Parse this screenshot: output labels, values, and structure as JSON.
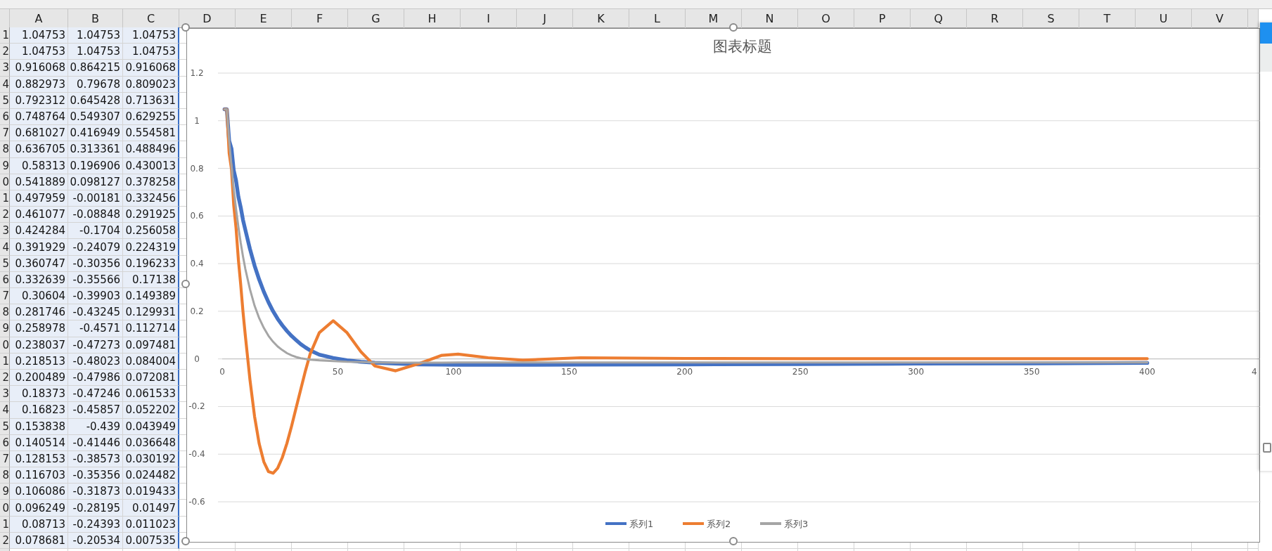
{
  "columns": [
    "A",
    "B",
    "C",
    "D",
    "E",
    "F",
    "G",
    "H",
    "I",
    "J",
    "K",
    "L",
    "M",
    "N",
    "O",
    "P",
    "Q",
    "R",
    "S",
    "T",
    "U",
    "V"
  ],
  "rows": [
    {
      "header": "1",
      "cells": [
        "1.04753",
        "1.04753",
        "1.04753"
      ]
    },
    {
      "header": "2",
      "cells": [
        "1.04753",
        "1.04753",
        "1.04753"
      ]
    },
    {
      "header": "3",
      "cells": [
        "0.916068",
        "0.864215",
        "0.916068"
      ]
    },
    {
      "header": "4",
      "cells": [
        "0.882973",
        "0.79678",
        "0.809023"
      ]
    },
    {
      "header": "5",
      "cells": [
        "0.792312",
        "0.645428",
        "0.713631"
      ]
    },
    {
      "header": "6",
      "cells": [
        "0.748764",
        "0.549307",
        "0.629255"
      ]
    },
    {
      "header": "7",
      "cells": [
        "0.681027",
        "0.416949",
        "0.554581"
      ]
    },
    {
      "header": "8",
      "cells": [
        "0.636705",
        "0.313361",
        "0.488496"
      ]
    },
    {
      "header": "9",
      "cells": [
        "0.58313",
        "0.196906",
        "0.430013"
      ]
    },
    {
      "header": "0",
      "cells": [
        "0.541889",
        "0.098127",
        "0.378258"
      ]
    },
    {
      "header": "1",
      "cells": [
        "0.497959",
        "-0.00181",
        "0.332456"
      ]
    },
    {
      "header": "2",
      "cells": [
        "0.461077",
        "-0.08848",
        "0.291925"
      ]
    },
    {
      "header": "3",
      "cells": [
        "0.424284",
        "-0.1704",
        "0.256058"
      ]
    },
    {
      "header": "4",
      "cells": [
        "0.391929",
        "-0.24079",
        "0.224319"
      ]
    },
    {
      "header": "5",
      "cells": [
        "0.360747",
        "-0.30356",
        "0.196233"
      ]
    },
    {
      "header": "6",
      "cells": [
        "0.332639",
        "-0.35566",
        "0.17138"
      ]
    },
    {
      "header": "7",
      "cells": [
        "0.30604",
        "-0.39903",
        "0.149389"
      ]
    },
    {
      "header": "8",
      "cells": [
        "0.281746",
        "-0.43245",
        "0.129931"
      ]
    },
    {
      "header": "9",
      "cells": [
        "0.258978",
        "-0.4571",
        "0.112714"
      ]
    },
    {
      "header": "0",
      "cells": [
        "0.238037",
        "-0.47273",
        "0.097481"
      ]
    },
    {
      "header": "1",
      "cells": [
        "0.218513",
        "-0.48023",
        "0.084004"
      ]
    },
    {
      "header": "2",
      "cells": [
        "0.200489",
        "-0.47986",
        "0.072081"
      ]
    },
    {
      "header": "3",
      "cells": [
        "0.18373",
        "-0.47246",
        "0.061533"
      ]
    },
    {
      "header": "4",
      "cells": [
        "0.16823",
        "-0.45857",
        "0.052202"
      ]
    },
    {
      "header": "5",
      "cells": [
        "0.153838",
        "-0.439",
        "0.043949"
      ]
    },
    {
      "header": "6",
      "cells": [
        "0.140514",
        "-0.41446",
        "0.036648"
      ]
    },
    {
      "header": "7",
      "cells": [
        "0.128153",
        "-0.38573",
        "0.030192"
      ]
    },
    {
      "header": "8",
      "cells": [
        "0.116703",
        "-0.35356",
        "0.024482"
      ]
    },
    {
      "header": "9",
      "cells": [
        "0.106086",
        "-0.31873",
        "0.019433"
      ]
    },
    {
      "header": "0",
      "cells": [
        "0.096249",
        "-0.28195",
        "0.01497"
      ]
    },
    {
      "header": "1",
      "cells": [
        "0.08713",
        "-0.24393",
        "0.011023"
      ]
    },
    {
      "header": "2",
      "cells": [
        "0.078681",
        "-0.20534",
        "0.007535"
      ]
    }
  ],
  "chart": {
    "chart_data": {
      "type": "line",
      "title": "图表标题",
      "x": [
        1,
        2,
        3,
        4,
        5,
        6,
        7,
        8,
        9,
        10,
        12,
        14,
        16,
        18,
        20,
        22,
        24,
        26,
        28,
        30,
        32,
        34,
        36,
        38,
        42,
        48,
        54,
        60,
        66,
        75,
        85,
        95,
        102,
        115,
        130,
        155,
        200,
        250,
        300,
        350,
        400
      ],
      "series": [
        {
          "name": "系列1",
          "color": "#4472c4",
          "values": [
            1.048,
            1.048,
            0.916,
            0.883,
            0.792,
            0.749,
            0.681,
            0.637,
            0.583,
            0.542,
            0.461,
            0.392,
            0.333,
            0.282,
            0.238,
            0.2,
            0.168,
            0.141,
            0.117,
            0.096,
            0.079,
            0.062,
            0.048,
            0.036,
            0.018,
            0.004,
            -0.006,
            -0.012,
            -0.016,
            -0.02,
            -0.023,
            -0.024,
            -0.025,
            -0.025,
            -0.025,
            -0.024,
            -0.023,
            -0.022,
            -0.02,
            -0.019,
            -0.017
          ]
        },
        {
          "name": "系列2",
          "color": "#ed7d31",
          "values": [
            1.048,
            1.048,
            0.864,
            0.797,
            0.645,
            0.549,
            0.417,
            0.313,
            0.197,
            0.098,
            -0.088,
            -0.241,
            -0.356,
            -0.432,
            -0.473,
            -0.48,
            -0.459,
            -0.414,
            -0.354,
            -0.282,
            -0.205,
            -0.127,
            -0.05,
            0.02,
            0.11,
            0.16,
            0.11,
            0.03,
            -0.03,
            -0.05,
            -0.02,
            0.015,
            0.02,
            0.005,
            -0.005,
            0.005,
            0.002,
            0.001,
            0.001,
            0.001,
            0.001
          ]
        },
        {
          "name": "系列3",
          "color": "#a5a5a5",
          "values": [
            1.048,
            1.048,
            0.916,
            0.809,
            0.714,
            0.629,
            0.555,
            0.488,
            0.43,
            0.378,
            0.292,
            0.224,
            0.171,
            0.13,
            0.097,
            0.072,
            0.052,
            0.037,
            0.024,
            0.015,
            0.008,
            0.003,
            0.0,
            -0.003,
            -0.006,
            -0.009,
            -0.012,
            -0.013,
            -0.015,
            -0.016,
            -0.016,
            -0.016,
            -0.015,
            -0.015,
            -0.015,
            -0.015,
            -0.015,
            -0.015,
            -0.015,
            -0.015,
            -0.015
          ]
        }
      ],
      "xlim": [
        0,
        450
      ],
      "ylim": [
        -0.6,
        1.2
      ],
      "xticks": [
        0,
        50,
        100,
        150,
        200,
        250,
        300,
        350,
        400
      ],
      "grid": true,
      "legend": "bottom",
      "yticks": [
        1.2,
        1,
        0.8,
        0.6,
        0.4,
        0.2,
        0,
        -0.2,
        -0.4,
        -0.6
      ]
    },
    "cut_tick_label": "4"
  }
}
